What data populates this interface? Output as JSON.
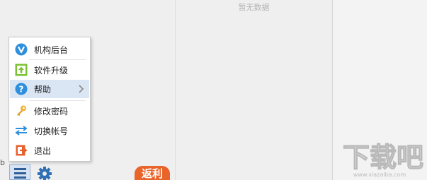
{
  "empty_state": {
    "text": "暂无数据"
  },
  "left_edge_text": "b",
  "menu": {
    "items": [
      {
        "label": "机构后台",
        "icon": "v-logo-icon"
      },
      {
        "label": "软件升级",
        "icon": "upgrade-icon"
      },
      {
        "label": "帮助",
        "icon": "help-icon",
        "has_submenu": true
      },
      {
        "label": "修改密码",
        "icon": "key-icon"
      },
      {
        "label": "切换帐号",
        "icon": "switch-icon"
      },
      {
        "label": "退出",
        "icon": "exit-icon"
      }
    ]
  },
  "bottom_bar": {
    "badge_label": "返利"
  },
  "watermark": {
    "text": "下载吧",
    "url": "www.xiazaiba.com"
  },
  "colors": {
    "accent": "#2e8fdc",
    "highlight": "#dbe6f5",
    "badge": "#e9642a",
    "upgrade": "#7cc235",
    "exit": "#e8602c"
  }
}
